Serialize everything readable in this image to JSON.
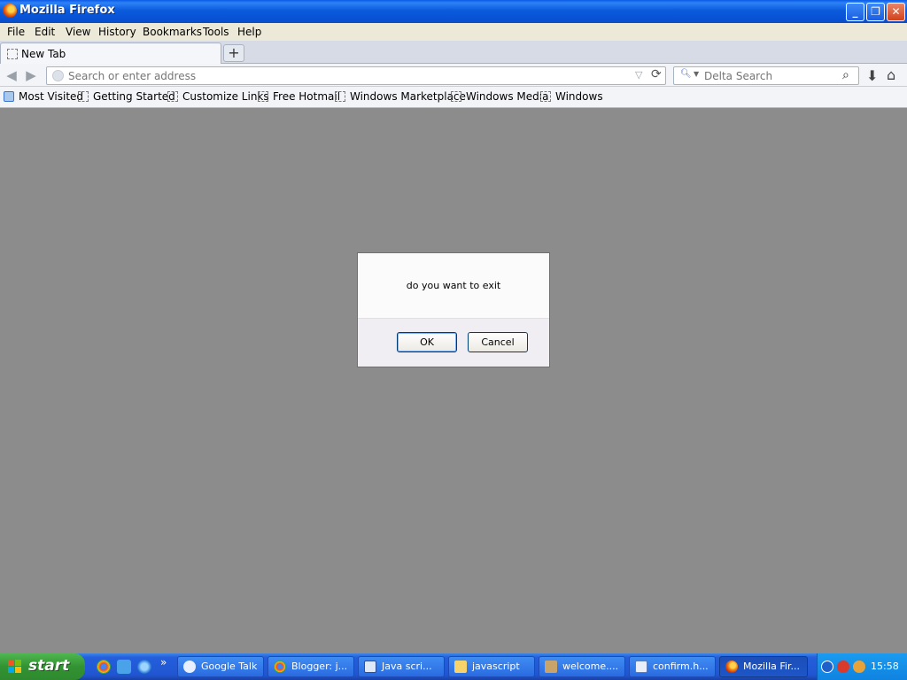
{
  "window": {
    "title": "Mozilla Firefox",
    "buttons": {
      "minimize": "_",
      "maximize": "❐",
      "close": "✕"
    }
  },
  "menubar": {
    "items": [
      "File",
      "Edit",
      "View",
      "History",
      "Bookmarks",
      "Tools",
      "Help"
    ]
  },
  "tabs": {
    "items": [
      {
        "label": "New Tab"
      }
    ],
    "new_tab_symbol": "+"
  },
  "navbar": {
    "back_symbol": "◀",
    "forward_symbol": "▶",
    "address_placeholder": "Search or enter address",
    "address_value": "",
    "search_placeholder": "Delta Search",
    "search_engine": "Delta"
  },
  "bookmarks": {
    "items": [
      "Most Visited",
      "Getting Started",
      "Customize Links",
      "Free Hotmail",
      "Windows Marketplace",
      "Windows Media",
      "Windows"
    ]
  },
  "dialog": {
    "message": "do you want to exit",
    "ok_label": "OK",
    "cancel_label": "Cancel"
  },
  "taskbar": {
    "start_label": "start",
    "quick_launch_more": "»",
    "tasks": [
      {
        "label": "Google Talk",
        "icon": "chat-icon"
      },
      {
        "label": "Blogger: j...",
        "icon": "chrome-icon"
      },
      {
        "label": "Java scri...",
        "icon": "word-icon"
      },
      {
        "label": "javascript",
        "icon": "folder-icon"
      },
      {
        "label": "welcome....",
        "icon": "app-icon"
      },
      {
        "label": "confirm.h...",
        "icon": "document-icon"
      },
      {
        "label": "Mozilla Fir...",
        "icon": "firefox-icon"
      }
    ],
    "clock": "15:58"
  },
  "colors": {
    "titlebar": "#0b5bdc",
    "taskbar": "#245edb",
    "start": "#329232",
    "content": "#8c8c8c"
  }
}
